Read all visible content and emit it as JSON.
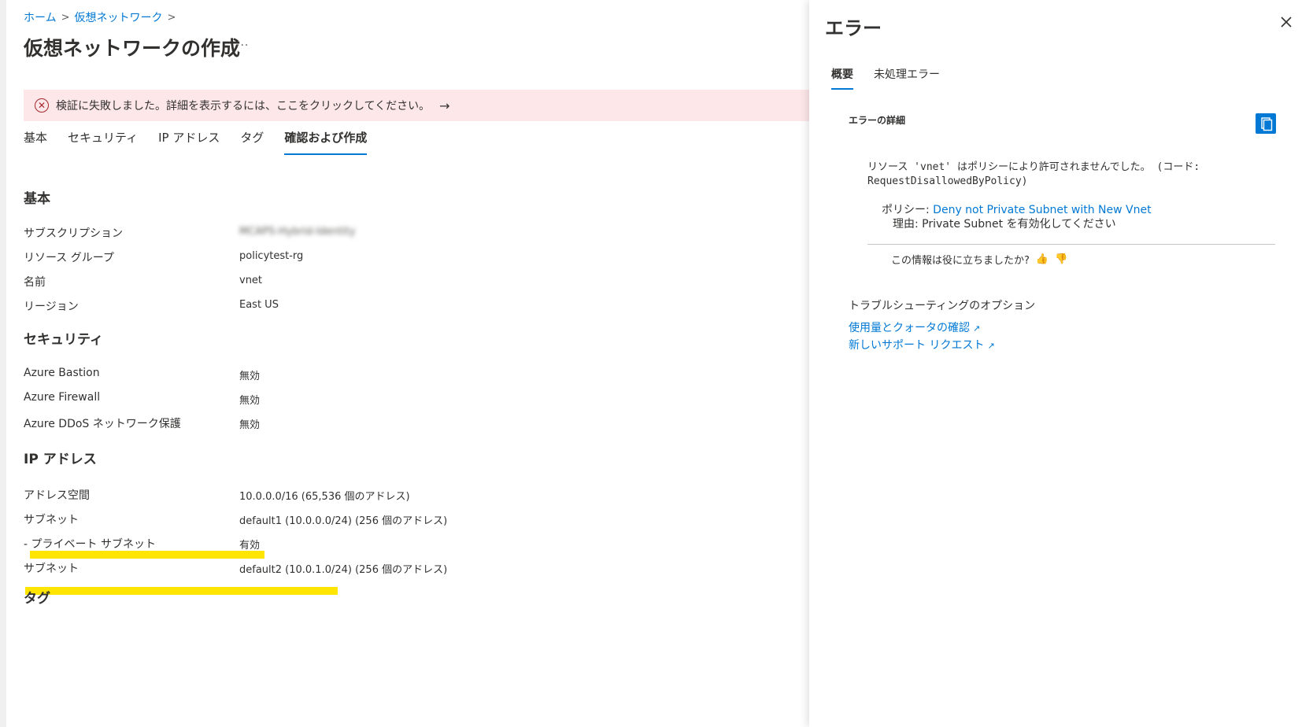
{
  "breadcrumb": {
    "home": "ホーム",
    "vnet": "仮想ネットワーク"
  },
  "page": {
    "title": "仮想ネットワークの作成",
    "more": "···"
  },
  "banner": {
    "message": "検証に失敗しました。詳細を表示するには、ここをクリックしてください。",
    "icon": "error-circle-icon"
  },
  "tabs": [
    "基本",
    "セキュリティ",
    "IP アドレス",
    "タグ",
    "確認および作成"
  ],
  "sections": {
    "basic": {
      "heading": "基本",
      "rows": [
        {
          "label": "サブスクリプション",
          "value": "MCAPS-Hybrid-Identity"
        },
        {
          "label": "リソース グループ",
          "value": "policytest-rg"
        },
        {
          "label": "名前",
          "value": "vnet"
        },
        {
          "label": "リージョン",
          "value": "East US"
        }
      ]
    },
    "security": {
      "heading": "セキュリティ",
      "rows": [
        {
          "label": "Azure Bastion",
          "value": "無効"
        },
        {
          "label": "Azure Firewall",
          "value": "無効"
        },
        {
          "label": "Azure DDoS ネットワーク保護",
          "value": "無効"
        }
      ]
    },
    "ip": {
      "heading": "IP アドレス",
      "rows": [
        {
          "label": "アドレス空間",
          "value": "10.0.0.0/16 (65,536 個のアドレス)"
        },
        {
          "label": "サブネット",
          "value": "default1 (10.0.0.0/24) (256 個のアドレス)"
        },
        {
          "label": "- プライベート サブネット",
          "value": "有効"
        },
        {
          "label": "サブネット",
          "value": "default2 (10.0.1.0/24) (256 個のアドレス)"
        }
      ]
    },
    "tags": {
      "heading": "タグ"
    }
  },
  "panel": {
    "title": "エラー",
    "tabs": [
      "概要",
      "未処理エラー"
    ],
    "error_details_label": "エラーの詳細",
    "message_line1": "リソース 'vnet' はポリシーにより許可されませんでした。 (コード:",
    "message_line2": "RequestDisallowedByPolicy)",
    "policy_label": "ポリシー: ",
    "policy_link": "Deny not Private Subnet with New Vnet",
    "reason_label": "理由: ",
    "reason_text": "Private Subnet を有効化してください",
    "feedback_question": "この情報は役に立ちましたか?",
    "troubleshoot_label": "トラブルシューティングのオプション",
    "links": [
      "使用量とクォータの確認",
      "新しいサポート リクエスト"
    ]
  },
  "colors": {
    "accent": "#0078d4",
    "error_bg": "#fde7e9",
    "error_icon": "#a4262c",
    "highlight": "#ffe500"
  }
}
